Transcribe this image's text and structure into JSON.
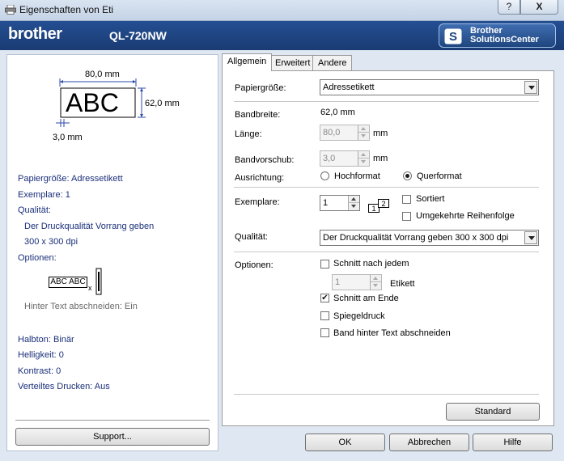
{
  "window": {
    "title": "Eigenschaften von Eti",
    "help_label": "?",
    "close_label": "X"
  },
  "brand": {
    "logo_text": "brother",
    "model": "QL-720NW",
    "solutions_line1": "Brother",
    "solutions_line2": "SolutionsCenter"
  },
  "preview": {
    "width_label": "80,0 mm",
    "height_label": "62,0 mm",
    "margin_label": "3,0 mm",
    "sample_text": "ABC"
  },
  "summary": {
    "papiergroesse": "Papiergröße: Adressetikett",
    "exemplare": "Exemplare: 1",
    "qualitaet_label": "Qualität:",
    "qualitaet_line1": "Der Druckqualität Vorrang geben",
    "qualitaet_line2": "300 x 300 dpi",
    "optionen_label": "Optionen:",
    "option_sample": "ABC ABC",
    "option_sample_mark": "x",
    "option_note": "Hinter Text abschneiden: Ein",
    "halbton": "Halbton: Binär",
    "helligkeit": "Helligkeit:   0",
    "kontrast": "Kontrast:   0",
    "verteiltes": "Verteiltes Drucken: Aus",
    "support_button": "Support..."
  },
  "tabs": [
    {
      "label": "Allgemein",
      "active": true
    },
    {
      "label": "Erweitert",
      "active": false
    },
    {
      "label": "Andere",
      "active": false
    }
  ],
  "general": {
    "papier_label": "Papiergröße:",
    "papier_value": "Adressetikett",
    "bandbreite_label": "Bandbreite:",
    "bandbreite_value": "62,0 mm",
    "laenge_label": "Länge:",
    "laenge_value": "80,0",
    "laenge_unit": "mm",
    "vorschub_label": "Bandvorschub:",
    "vorschub_value": "3,0",
    "vorschub_unit": "mm",
    "ausrichtung_label": "Ausrichtung:",
    "hochformat": "Hochformat",
    "querformat": "Querformat",
    "exemplare_label": "Exemplare:",
    "exemplare_value": "1",
    "collate_icon_1": "1",
    "collate_icon_2": "2",
    "sortiert": "Sortiert",
    "umgekehrt": "Umgekehrte Reihenfolge",
    "qualitaet_label": "Qualität:",
    "qualitaet_value": "Der Druckqualität Vorrang geben 300 x 300 dpi",
    "optionen_label": "Optionen:",
    "schnitt_nach": "Schnitt nach jedem",
    "schnitt_count": "1",
    "etikett": "Etikett",
    "schnitt_ende": "Schnitt am Ende",
    "spiegel": "Spiegeldruck",
    "band_hinter": "Band hinter Text abschneiden",
    "standard_button": "Standard",
    "check_mark": "✔"
  },
  "footer": {
    "ok": "OK",
    "abbrechen": "Abbrechen",
    "hilfe": "Hilfe"
  },
  "colors": {
    "brand_blue": "#1f4482",
    "summary_text": "#1a2f7a"
  }
}
